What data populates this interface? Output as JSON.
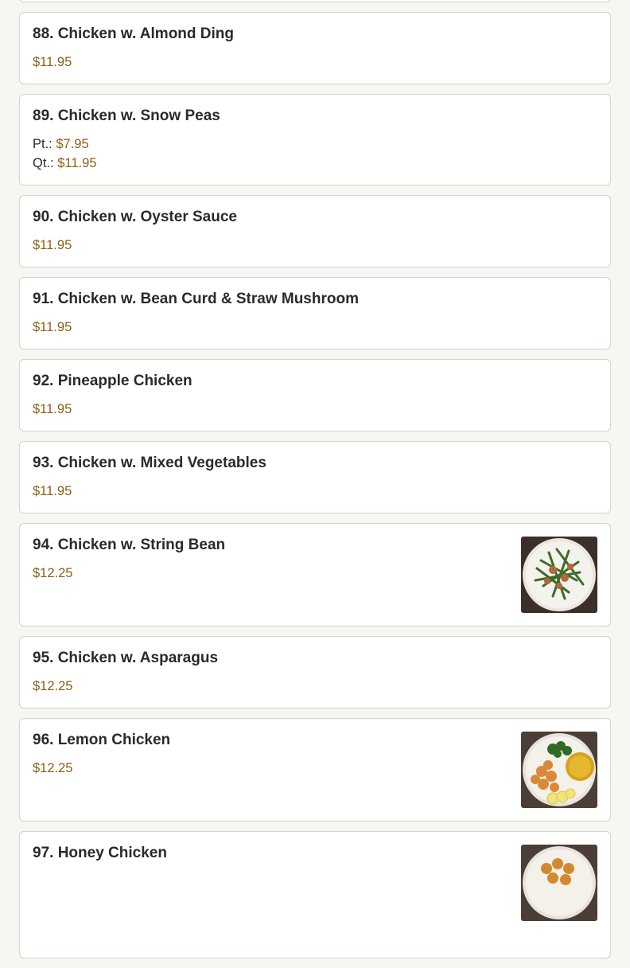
{
  "menu": {
    "items": [
      {
        "title": "88. Chicken w. Almond Ding",
        "price": "$11.95"
      },
      {
        "title": "89. Chicken w. Snow Peas",
        "pt_label": "Pt.:",
        "pt_price": "$7.95",
        "qt_label": "Qt.:",
        "qt_price": "$11.95"
      },
      {
        "title": "90. Chicken w. Oyster Sauce",
        "price": "$11.95"
      },
      {
        "title": "91. Chicken w. Bean Curd & Straw Mushroom",
        "price": "$11.95"
      },
      {
        "title": "92. Pineapple Chicken",
        "price": "$11.95"
      },
      {
        "title": "93. Chicken w. Mixed Vegetables",
        "price": "$11.95"
      },
      {
        "title": "94. Chicken w. String Bean",
        "price": "$12.25"
      },
      {
        "title": "95. Chicken w. Asparagus",
        "price": "$12.25"
      },
      {
        "title": "96. Lemon Chicken",
        "price": "$12.25"
      },
      {
        "title": "97. Honey Chicken"
      }
    ]
  },
  "colors": {
    "background": "#f8f6f2",
    "card": "#ffffff",
    "border": "#d6d2cc",
    "title": "#2a2a2a",
    "price": "#8a6117"
  }
}
